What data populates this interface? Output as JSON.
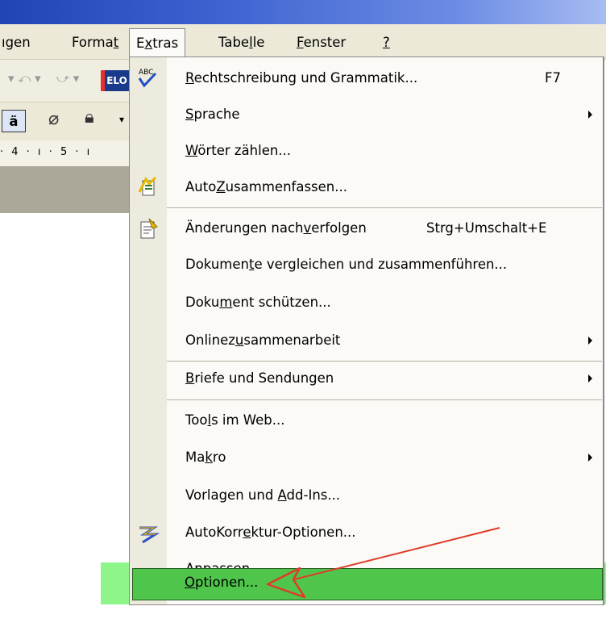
{
  "menubar": {
    "items": [
      {
        "label": "ıgen"
      },
      {
        "label": "Format"
      },
      {
        "label": "Extras"
      },
      {
        "label": "Tabelle"
      },
      {
        "label": "Fenster"
      },
      {
        "label": "?"
      }
    ]
  },
  "toolbar": {
    "elo_label": "ELO"
  },
  "ruler": {
    "text": "· 4 · ı · 5 · ı"
  },
  "extras_menu": {
    "items": [
      {
        "label": "Rechtschreibung und Grammatik...",
        "shortcut": "F7",
        "icon": "spellcheck-icon"
      },
      {
        "label": "Sprache",
        "submenu": true
      },
      {
        "label": "Wörter zählen..."
      },
      {
        "label": "AutoZusammenfassen...",
        "icon": "autosummarize-icon"
      },
      {
        "label": "Änderungen nachverfolgen",
        "shortcut": "Strg+Umschalt+E",
        "icon": "track-changes-icon"
      },
      {
        "label": "Dokumente vergleichen und zusammenführen..."
      },
      {
        "label": "Dokument schützen..."
      },
      {
        "label": "Onlinezusammenarbeit",
        "submenu": true
      },
      {
        "label": "Briefe und Sendungen",
        "submenu": true
      },
      {
        "label": "Tools im Web..."
      },
      {
        "label": "Makro",
        "submenu": true
      },
      {
        "label": "Vorlagen und Add-Ins..."
      },
      {
        "label": "AutoKorrektur-Optionen...",
        "icon": "autocorrect-icon"
      },
      {
        "label": "Anpassen..."
      },
      {
        "label": "Optionen...",
        "highlighted": true
      }
    ]
  },
  "colors": {
    "highlight_green": "#4fc64b",
    "highlight_band": "#8ef58a",
    "annotation_arrow": "#e03a2a",
    "title_blue": "#1f44b4"
  }
}
